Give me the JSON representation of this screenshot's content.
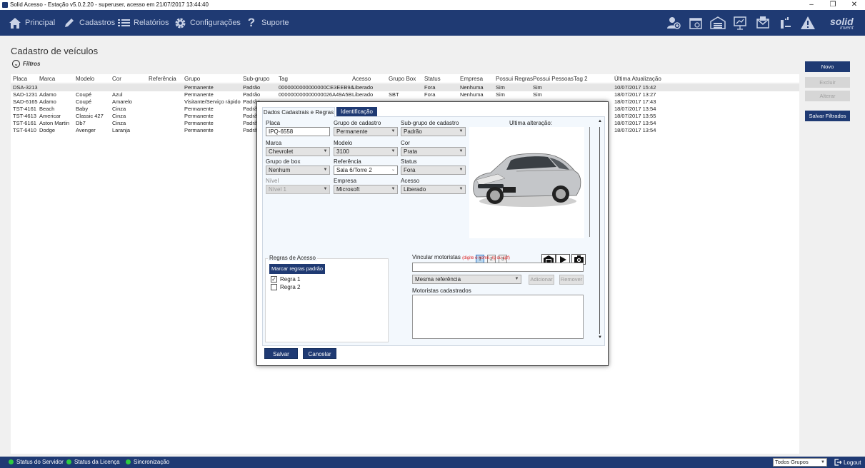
{
  "window": {
    "title": "Solid Acesso - Estação v5.0.2.20 - superuser, acesso em 21/07/2017 13:44:40"
  },
  "nav": {
    "items": [
      {
        "label": "Principal",
        "icon": "home-icon"
      },
      {
        "label": "Cadastros",
        "icon": "pencil-icon"
      },
      {
        "label": "Relatórios",
        "icon": "list-icon"
      },
      {
        "label": "Configurações",
        "icon": "gear-icon"
      },
      {
        "label": "Suporte",
        "icon": "question-icon"
      }
    ],
    "tools": [
      "add-user-icon",
      "calendar-icon",
      "garage-icon",
      "chart-board-icon",
      "mail-icon",
      "key-card-icon",
      "warning-icon"
    ],
    "brand": {
      "name": "solid",
      "sub": "invent"
    }
  },
  "page": {
    "title": "Cadastro de veículos",
    "filters_label": "Filtros"
  },
  "grid": {
    "columns": [
      "Placa",
      "Marca",
      "Modelo",
      "Cor",
      "Referência",
      "Grupo",
      "Sub-grupo",
      "Tag",
      "Acesso",
      "Grupo Box",
      "Status",
      "Empresa",
      "Possui Regras",
      "Possui Pessoas",
      "Tag 2",
      "Última Atualização"
    ],
    "rows": [
      [
        "DSA-3213",
        "",
        "",
        "",
        "",
        "Permanente",
        "Padrão",
        "0000000000000000CE3EEB9A",
        "Liberado",
        "",
        "Fora",
        "Nenhuma",
        "Sim",
        "Sim",
        "",
        "10/07/2017 15:42"
      ],
      [
        "SAD-1231",
        "Adamo",
        "Coupé",
        "Azul",
        "",
        "Permanente",
        "Padrão",
        "000000000000000026A49A5B",
        "Liberado",
        "SBT",
        "Fora",
        "Nenhuma",
        "Sim",
        "Sim",
        "",
        "18/07/2017 13:27"
      ],
      [
        "SAD-6165",
        "Adamo",
        "Coupé",
        "Amarelo",
        "",
        "Visitante/Serviço rápido",
        "Padrão",
        "",
        "",
        "",
        "",
        "",
        "",
        "",
        "",
        "18/07/2017 17:43"
      ],
      [
        "TST-4161",
        "Beach",
        "Baby",
        "Cinza",
        "",
        "Permanente",
        "Padrã",
        "",
        "",
        "",
        "",
        "",
        "",
        "",
        "",
        "18/07/2017 13:54"
      ],
      [
        "TST-4613",
        "Americar",
        "Classic 427",
        "Cinza",
        "",
        "Permanente",
        "Padrã",
        "",
        "",
        "",
        "",
        "",
        "",
        "",
        "",
        "18/07/2017 13:55"
      ],
      [
        "TST-6161",
        "Aston Martin",
        "Db7",
        "Cinza",
        "",
        "Permanente",
        "Padrã",
        "",
        "",
        "",
        "",
        "",
        "",
        "",
        "",
        "18/07/2017 13:54"
      ],
      [
        "TST-6410",
        "Dodge",
        "Avenger",
        "Laranja",
        "",
        "Permanente",
        "Padrã",
        "",
        "",
        "",
        "",
        "",
        "",
        "",
        "",
        "18/07/2017 13:54"
      ]
    ]
  },
  "sidebar": {
    "novo": "Novo",
    "excluir": "Excluir",
    "alterar": "Alterar",
    "salvar_filtrados": "Salvar Filtrados"
  },
  "modal": {
    "tabs": [
      "Dados Cadastrais e Regras",
      "Identificação"
    ],
    "fields": {
      "placa": {
        "label": "Placa",
        "value": "IPQ-6558"
      },
      "grupo": {
        "label": "Grupo de cadastro",
        "value": "Permanente"
      },
      "subgrupo": {
        "label": "Sub-grupo de cadastro",
        "value": "Padrão"
      },
      "marca": {
        "label": "Marca",
        "value": "Chevrolet"
      },
      "modelo": {
        "label": "Modelo",
        "value": "3100"
      },
      "cor": {
        "label": "Cor",
        "value": "Prata"
      },
      "grupo_box": {
        "label": "Grupo de box",
        "value": "Nenhum"
      },
      "referencia": {
        "label": "Referência",
        "value": "Sala 6/Torre 2"
      },
      "status": {
        "label": "Status",
        "value": "Fora"
      },
      "nivel": {
        "label": "Nível",
        "value": "Nível 1"
      },
      "empresa": {
        "label": "Empresa",
        "value": "Microsoft"
      },
      "acesso": {
        "label": "Acesso",
        "value": "Liberado"
      }
    },
    "last_change_label": "Ultima alteração:",
    "photo_pages": [
      "1",
      "2",
      "3"
    ],
    "regras": {
      "title": "Regras de Acesso",
      "mark_default": "Marcar regras padrão",
      "items": [
        {
          "label": "Regra 1",
          "checked": true
        },
        {
          "label": "Regra 2",
          "checked": false
        }
      ]
    },
    "motoristas": {
      "label": "Vincular motoristas",
      "hint": "(digite o nome, rg ou cpf)",
      "input_value": "",
      "filter_value": "Mesma referência",
      "add": "Adicionar",
      "remove": "Remover",
      "list_label": "Motoristas cadastrados"
    },
    "save": "Salvar",
    "cancel": "Cancelar"
  },
  "statusbar": {
    "items": [
      "Status do Servidor",
      "Status da Licença",
      "Sincronização"
    ],
    "group_select": "Todos Grupos",
    "logout": "Logout"
  }
}
